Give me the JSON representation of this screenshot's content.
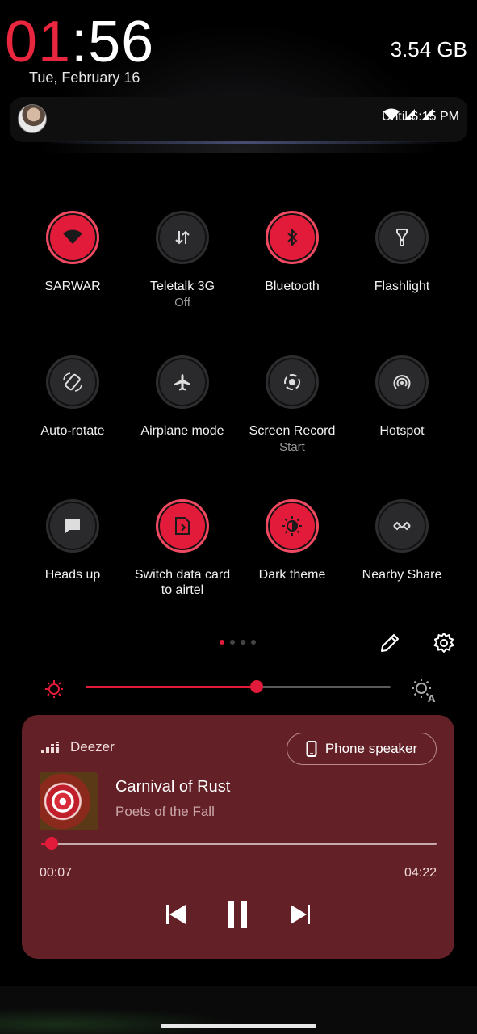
{
  "clock": {
    "hours": "01",
    "separator": ":",
    "minutes": "56"
  },
  "date": "Tue, February 16",
  "storage": "3.54 GB",
  "status": {
    "until": "Until 6:15 PM"
  },
  "tiles": [
    {
      "label": "SARWAR",
      "sub": "",
      "on": true,
      "icon": "wifi-icon"
    },
    {
      "label": "Teletalk 3G",
      "sub": "Off",
      "on": false,
      "icon": "mobile-data-icon"
    },
    {
      "label": "Bluetooth",
      "sub": "",
      "on": true,
      "icon": "bluetooth-icon"
    },
    {
      "label": "Flashlight",
      "sub": "",
      "on": false,
      "icon": "flashlight-icon"
    },
    {
      "label": "Auto-rotate",
      "sub": "",
      "on": false,
      "icon": "auto-rotate-icon"
    },
    {
      "label": "Airplane mode",
      "sub": "",
      "on": false,
      "icon": "airplane-icon"
    },
    {
      "label": "Screen Record",
      "sub": "Start",
      "on": false,
      "icon": "screen-record-icon"
    },
    {
      "label": "Hotspot",
      "sub": "",
      "on": false,
      "icon": "hotspot-icon"
    },
    {
      "label": "Heads up",
      "sub": "",
      "on": false,
      "icon": "heads-up-icon"
    },
    {
      "label": "Switch data card\nto airtel",
      "sub": "",
      "on": true,
      "icon": "sim-card-icon"
    },
    {
      "label": "Dark theme",
      "sub": "",
      "on": true,
      "icon": "dark-theme-icon"
    },
    {
      "label": "Nearby Share",
      "sub": "",
      "on": false,
      "icon": "nearby-share-icon"
    }
  ],
  "tile_label_0": "SARWAR",
  "tile_label_1": "Teletalk 3G",
  "tile_sub_1": "Off",
  "tile_label_2": "Bluetooth",
  "tile_label_3": "Flashlight",
  "tile_label_4": "Auto-rotate",
  "tile_label_5": "Airplane mode",
  "tile_label_6": "Screen Record",
  "tile_sub_6": "Start",
  "tile_label_7": "Hotspot",
  "tile_label_8": "Heads up",
  "tile_label_9a": "Switch data card",
  "tile_label_9b": "to airtel",
  "tile_label_10": "Dark theme",
  "tile_label_11": "Nearby Share",
  "pager": {
    "pages": 4,
    "current": 1
  },
  "brightness": {
    "level": 0.56
  },
  "media": {
    "app": "Deezer",
    "output": "Phone speaker",
    "title": "Carnival of Rust",
    "artist": "Poets of the Fall",
    "elapsed": "00:07",
    "total": "04:22",
    "progress": 0.027
  },
  "colors": {
    "accent": "#e21b3a",
    "media_bg": "#632026",
    "tile_off": "#2a2a2c"
  }
}
